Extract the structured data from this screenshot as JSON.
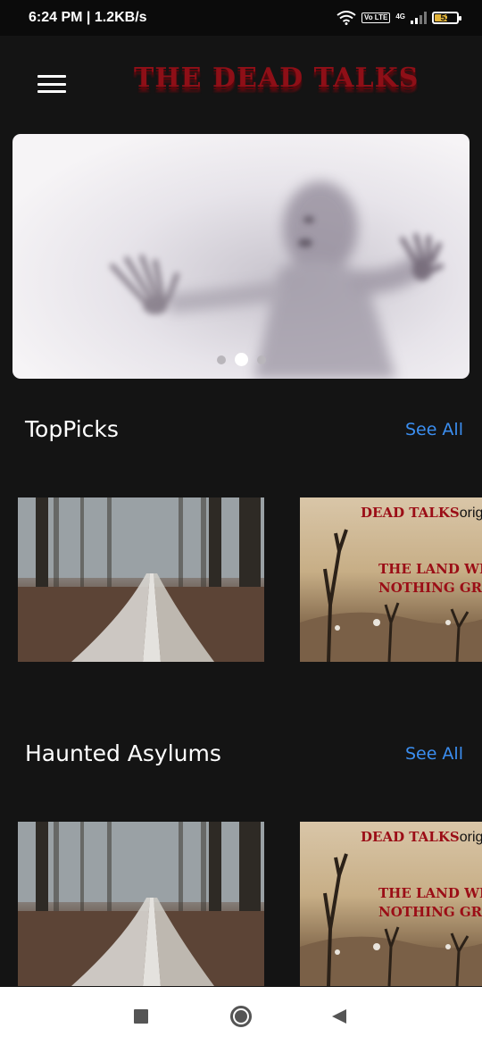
{
  "status_bar": {
    "time": "6:24 PM | 1.2KB/s",
    "volte_badge": "Vo LTE",
    "network": "4G",
    "battery": "53",
    "battery_fraction": 0.53
  },
  "header": {
    "title": "THE DEAD TALKS",
    "menu_icon": "hamburger-menu-icon"
  },
  "hero": {
    "slide_count": 3,
    "active_slide": 1
  },
  "sections": [
    {
      "title": "TopPicks",
      "see_all": "See All",
      "cards": [
        {
          "type": "image",
          "subject": "foggy-forest-path"
        },
        {
          "brand": "DEAD TALKS",
          "brand_suffix": "original",
          "headline_line1": "THE LAND WHERE",
          "headline_line2": "NOTHING GROWS"
        }
      ]
    },
    {
      "title": "Haunted Asylums",
      "see_all": "See All",
      "cards": [
        {
          "type": "image",
          "subject": "foggy-forest-path"
        },
        {
          "brand": "DEAD TALKS",
          "brand_suffix": "original",
          "headline_line1": "THE LAND WHERE",
          "headline_line2": "NOTHING GROWS"
        }
      ]
    }
  ],
  "nav_bar": {
    "icons": [
      "recents-square-icon",
      "home-circle-icon",
      "back-triangle-icon"
    ]
  },
  "colors": {
    "background": "#141414",
    "title_red": "#8e0f17",
    "link_blue": "#3b8ef0"
  }
}
